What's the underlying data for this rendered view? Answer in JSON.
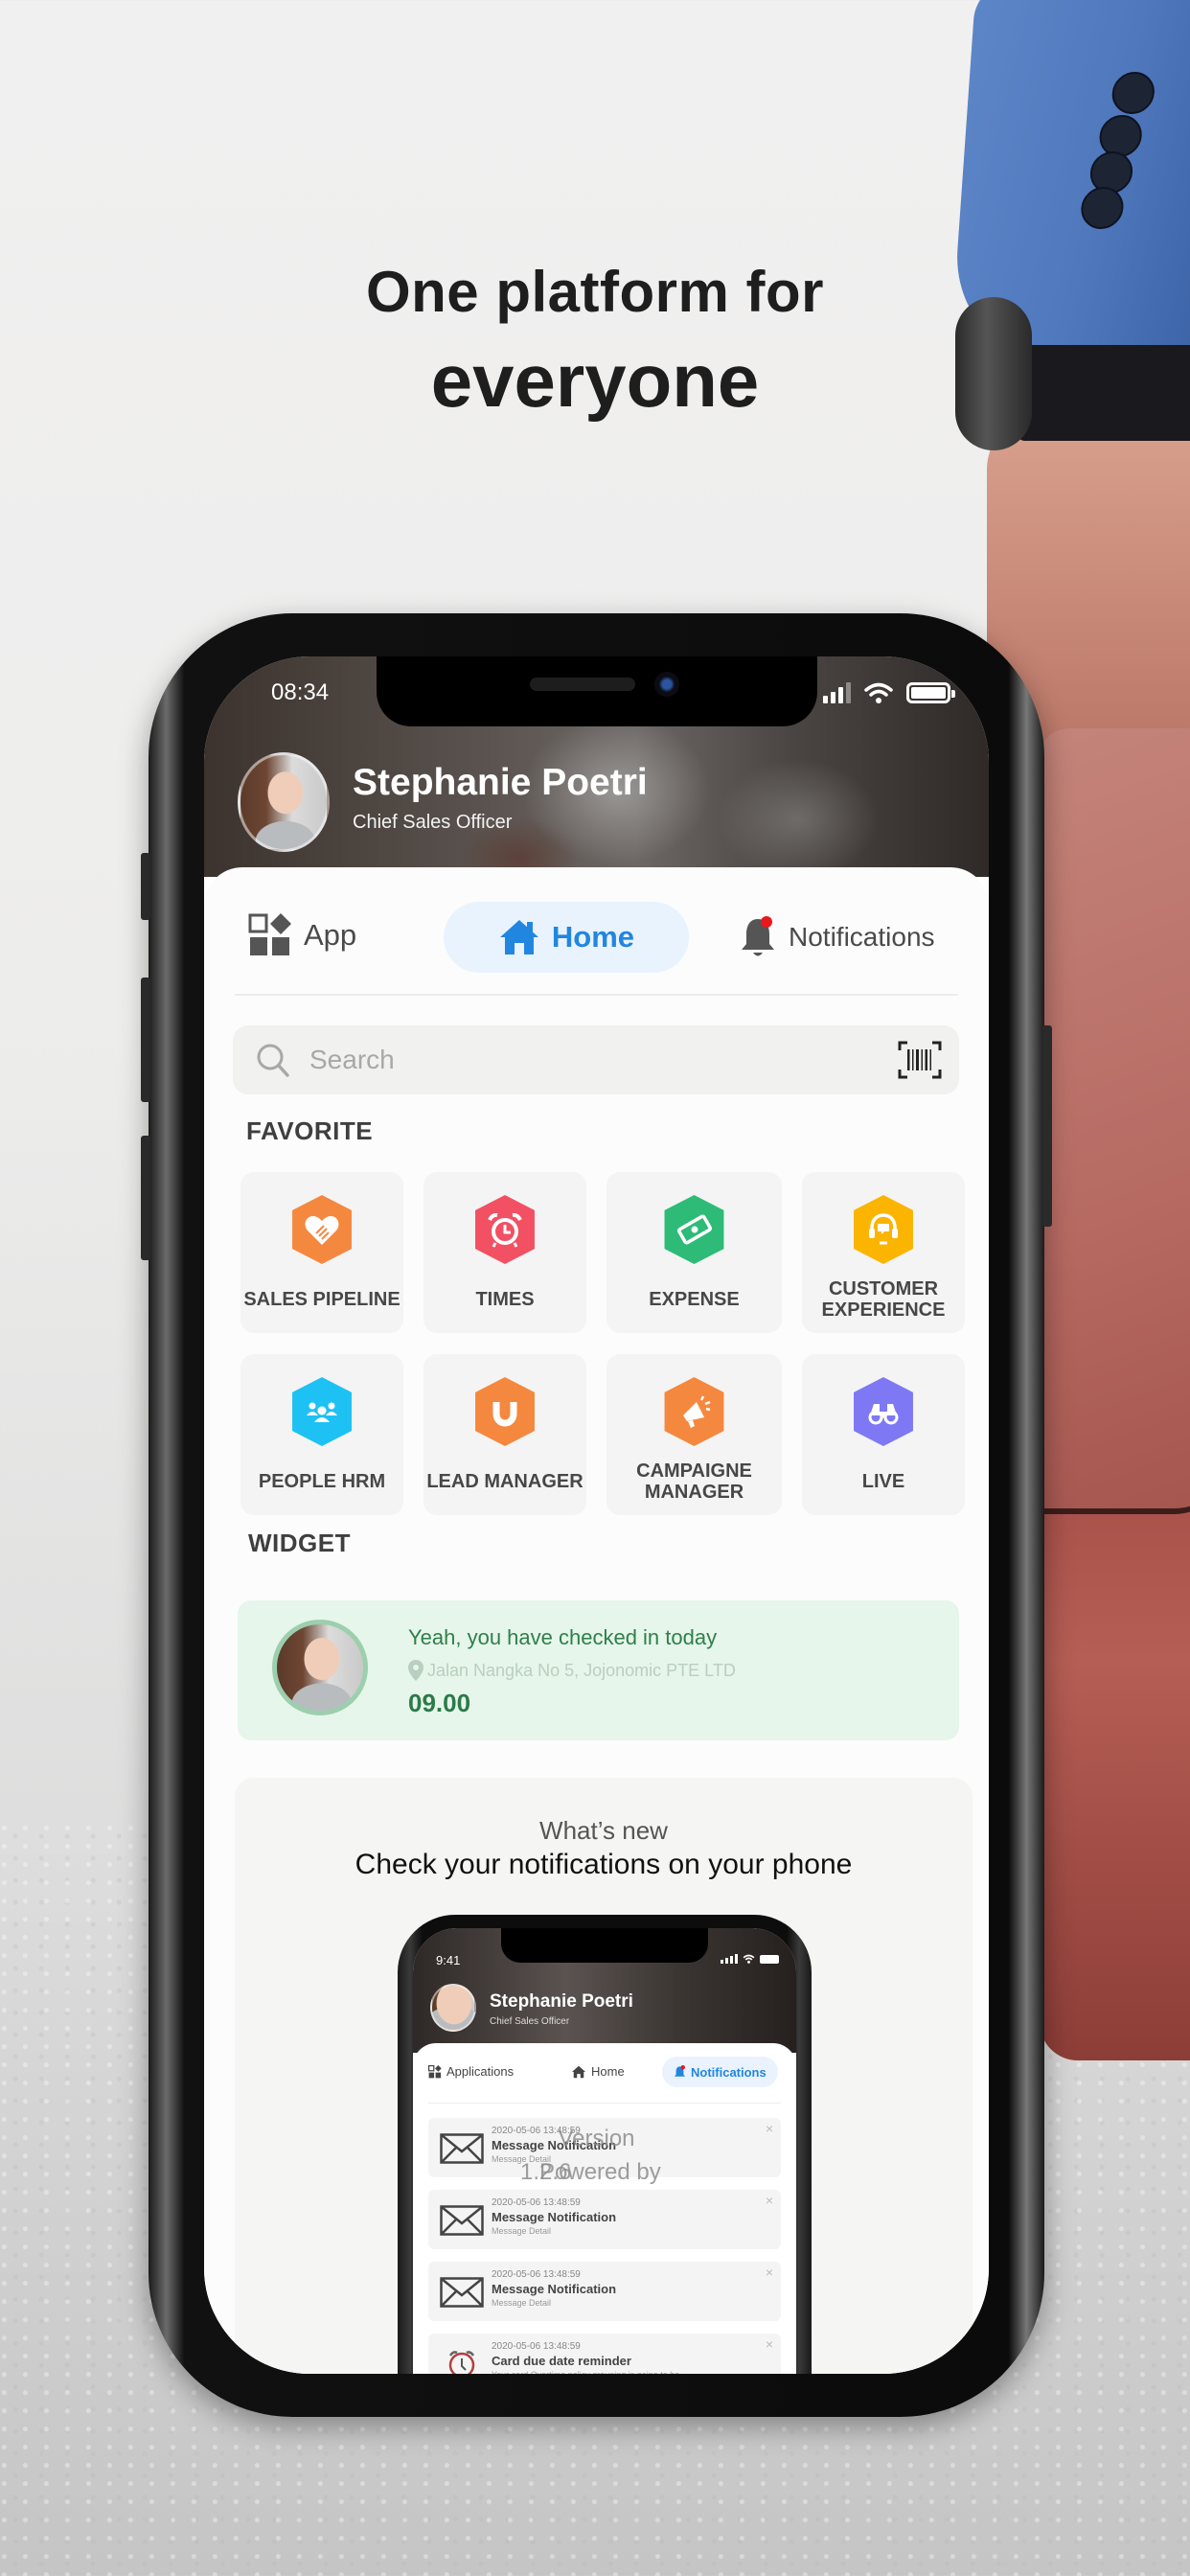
{
  "headline": {
    "line1": "One platform for",
    "line2": "everyone"
  },
  "status_bar": {
    "time": "08:34",
    "icons": [
      "signal-icon",
      "wifi-icon",
      "battery-icon"
    ]
  },
  "profile": {
    "name": "Stephanie Poetri",
    "role": "Chief Sales Officer"
  },
  "tabs": [
    {
      "label": "App",
      "icon": "apps-icon",
      "active": false
    },
    {
      "label": "Home",
      "icon": "home-icon",
      "active": true
    },
    {
      "label": "Notifications",
      "icon": "bell-icon",
      "active": false,
      "has_badge": true
    }
  ],
  "search": {
    "placeholder": "Search",
    "value": "",
    "scan_icon": "barcode-scan-icon"
  },
  "favorite": {
    "title": "FAVORITE",
    "items": [
      {
        "label": "SALES PIPELINE",
        "icon": "handshake-heart-icon",
        "color": "#f5883f"
      },
      {
        "label": "TIMES",
        "icon": "alarm-clock-icon",
        "color": "#f25063"
      },
      {
        "label": "EXPENSE",
        "icon": "money-bill-icon",
        "color": "#2dbb77"
      },
      {
        "label": "CUSTOMER EXPERIENCE",
        "icon": "headset-icon",
        "color": "#fbb400"
      },
      {
        "label": "PEOPLE HRM",
        "icon": "people-group-icon",
        "color": "#1ec1f3"
      },
      {
        "label": "LEAD MANAGER",
        "icon": "magnet-icon",
        "color": "#f5883f"
      },
      {
        "label": "CAMPAIGNE MANAGER",
        "icon": "megaphone-icon",
        "color": "#f5883f"
      },
      {
        "label": "LIVE",
        "icon": "binoculars-icon",
        "color": "#7f78f5"
      }
    ]
  },
  "widget": {
    "title": "WIDGET",
    "checkin": {
      "message": "Yeah, you have checked in today",
      "location": "Jalan Nangka No 5, Jojonomic PTE LTD",
      "time": "09.00"
    }
  },
  "whats_new": {
    "subtitle": "What’s new",
    "title": "Check your notifications on your phone",
    "preview": {
      "time": "9:41",
      "name": "Stephanie Poetri",
      "role": "Chief Sales Officer",
      "tabs": [
        {
          "label": "Applications",
          "active": false
        },
        {
          "label": "Home",
          "active": false
        },
        {
          "label": "Notifications",
          "active": true
        }
      ],
      "notifications": [
        {
          "timestamp": "2020-05-06 13:48:59",
          "title": "Message Notification",
          "detail": "Message Detail",
          "icon": "envelope-icon"
        },
        {
          "timestamp": "2020-05-06 13:48:59",
          "title": "Message Notification",
          "detail": "Message Detail",
          "icon": "envelope-icon"
        },
        {
          "timestamp": "2020-05-06 13:48:59",
          "title": "Message Notification",
          "detail": "Message Detail",
          "icon": "envelope-icon"
        },
        {
          "timestamp": "2020-05-06 13:48:59",
          "title": "Card due date reminder",
          "detail": "Your card Overtime policy grouping is going to be",
          "icon": "alarm-clock-icon"
        }
      ]
    }
  },
  "footer_overlay": {
    "version_label": "Version",
    "version_number": "1.2.6",
    "powered_by": "Powered by"
  },
  "colors": {
    "accent_blue": "#2186e0",
    "checkin_green": "#2f7f4b",
    "notification_badge": "#e8191d"
  }
}
